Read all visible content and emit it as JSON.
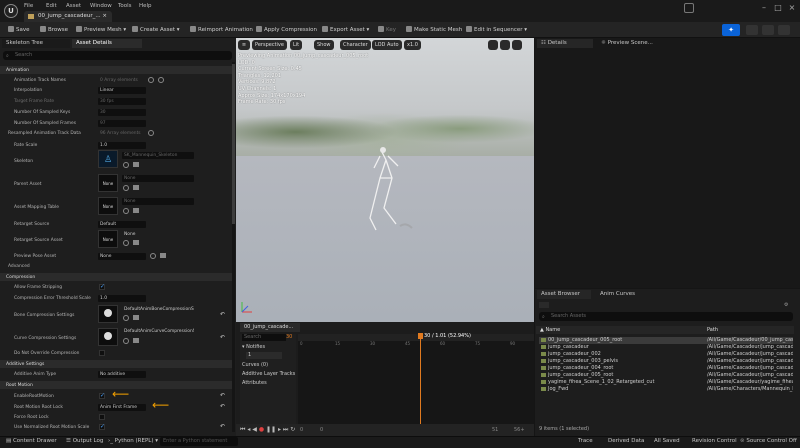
{
  "menu": [
    "File",
    "Edit",
    "Asset",
    "Window",
    "Tools",
    "Help"
  ],
  "document_tab": "00_jump_cascadeur_...",
  "toolbar": {
    "save": "Save",
    "browse": "Browse",
    "preview_mesh": "Preview Mesh",
    "create_asset": "Create Asset",
    "reimport": "Reimport Animation",
    "apply_compression": "Apply Compression",
    "export_asset": "Export Asset",
    "key": "Key",
    "make_static_mesh": "Make Static Mesh",
    "edit_in_sequencer": "Edit in Sequencer"
  },
  "left_panel": {
    "tabs": [
      "Skeleton Tree",
      "Asset Details"
    ],
    "search_placeholder": "Search",
    "sections": {
      "animation": "Animation",
      "compression": "Compression",
      "additive": "Additive Settings",
      "root_motion": "Root Motion",
      "advanced": "Advanced"
    },
    "rows": {
      "track_names": {
        "label": "Animation Track Names",
        "value": "0 Array elements"
      },
      "interpolation": {
        "label": "Interpolation",
        "value": "Linear"
      },
      "target_frame_rate": {
        "label": "Target Frame Rate",
        "value": "30 fps"
      },
      "sampled_keys": {
        "label": "Number Of Sampled Keys",
        "value": "30"
      },
      "sampled_frames": {
        "label": "Number Of Sampled Frames",
        "value": "97"
      },
      "resampled_track": {
        "label": "Resampled Animation Track Data",
        "value": "96 Array elements"
      },
      "rate_scale": {
        "label": "Rate Scale",
        "value": "1.0"
      },
      "skeleton": {
        "label": "Skeleton",
        "value": "SK_Mannequin_Skeleton"
      },
      "parent_asset": {
        "label": "Parent Asset",
        "value": "None",
        "thumb": "None"
      },
      "asset_mapping": {
        "label": "Asset Mapping Table",
        "value": "None",
        "thumb": "None"
      },
      "retarget_source": {
        "label": "Retarget Source",
        "value": "Default"
      },
      "retarget_source_asset": {
        "label": "Retarget Source Asset",
        "value": "None",
        "thumb": "None"
      },
      "preview_pose": {
        "label": "Preview Pose Asset",
        "value": "None"
      },
      "allow_frame_stripping": {
        "label": "Allow Frame Stripping"
      },
      "compression_threshold": {
        "label": "Compression Error Threshold Scale",
        "value": "1.0"
      },
      "bone_compression": {
        "label": "Bone Compression Settings",
        "value": "DefaultAnimBoneCompressionSettings"
      },
      "curve_compression": {
        "label": "Curve Compression Settings",
        "value": "DefaultAnimCurveCompressionSettings"
      },
      "do_not_override": {
        "label": "Do Not Override Compression"
      },
      "additive_anim_type": {
        "label": "Additive Anim Type",
        "value": "No additive"
      },
      "enable_root_motion": {
        "label": "EnableRootMotion"
      },
      "root_motion_lock": {
        "label": "Root Motion Root Lock",
        "value": "Anim First Frame"
      },
      "force_root_lock": {
        "label": "Force Root Lock"
      },
      "use_normalized_root": {
        "label": "Use Normalized Root Motion Scale"
      }
    }
  },
  "viewport": {
    "buttons": [
      "Perspective",
      "Lit",
      "Show",
      "Character",
      "LOD Auto"
    ],
    "speed": "x1.0",
    "stats": [
      "Previewing Animation 00_jump_cascadeur_005_root",
      "LOD: 0",
      "Current Screen Size: 0.45",
      "Triangles: 12,201",
      "Vertices: 9,872",
      "UV Channels: 1",
      "Approx Size: 174x170x194",
      "Frame Rate: 30 fps"
    ]
  },
  "timeline": {
    "tab": "00_jump_cascade...",
    "search_placeholder": "Search",
    "frame_field": "30",
    "notifies": "Notifies",
    "track_number": "1",
    "curves": "Curves",
    "curves_count": "(0)",
    "additive_layer": "Additive Layer Tracks",
    "attributes": "Attributes",
    "frame_readout": "30 / 1.01 (52.94%)",
    "ticks": [
      "0",
      "15",
      "30",
      "45",
      "60",
      "75",
      "90"
    ],
    "bottom": {
      "left": "0",
      "left2": "0",
      "right": "51",
      "right2": "56+"
    }
  },
  "right_panel": {
    "tabs": [
      "Details",
      "Preview Scene..."
    ]
  },
  "asset_browser": {
    "tabs": [
      "Asset Browser",
      "Anim Curves"
    ],
    "search_placeholder": "Search Assets",
    "col_name": "Name",
    "col_path": "Path",
    "rows": [
      {
        "name": "00_jump_cascadeur_005_root",
        "path": "/All/Game/Cascadeur/00_jump_cas"
      },
      {
        "name": "jump_cascadeur",
        "path": "/All/Game/Cascadeur/jump_cascadeu"
      },
      {
        "name": "jump_cascadeur_002",
        "path": "/All/Game/Cascadeur/jump_cascadeu"
      },
      {
        "name": "jump_cascadeur_003_pelvis",
        "path": "/All/Game/Cascadeur/jump_cascadeu"
      },
      {
        "name": "jump_cascadeur_004_root",
        "path": "/All/Game/Cascadeur/jump_cascadeu"
      },
      {
        "name": "jump_cascadeur_005_root",
        "path": "/All/Game/Cascadeur/jump_cascadeu"
      },
      {
        "name": "yagime_fihea_Scene_1_02_Retargeted_cut",
        "path": "/All/Game/Cascadeur/yagime_fihea"
      },
      {
        "name": "Jog_Fwd",
        "path": "/All/Game/Characters/Mannequin_I"
      }
    ],
    "count": "9 items (1 selected)"
  },
  "statusbar": {
    "content_drawer": "Content Drawer",
    "output_log": "Output Log",
    "cmd": "Python (REPL)",
    "cmd_placeholder": "Enter a Python statement",
    "trace": "Trace",
    "derived_data": "Derived Data",
    "all_saved": "All Saved",
    "revision_control": "Revision Control",
    "source_control": "Source Control Off"
  },
  "colors": {
    "accent_blue": "#0a63d8",
    "annotation_arrow": "#f4a000",
    "playhead": "#e07a20"
  }
}
